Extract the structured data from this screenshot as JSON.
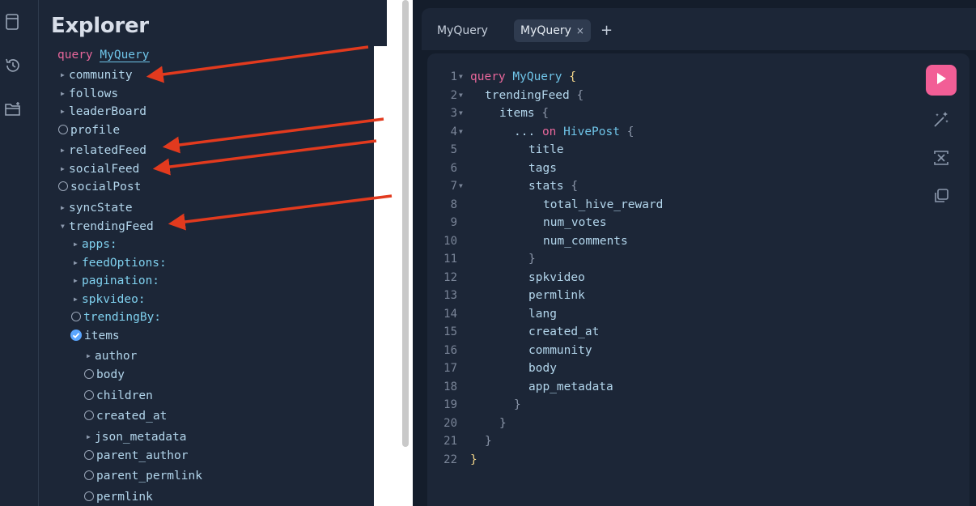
{
  "explorer": {
    "title": "Explorer",
    "query_keyword": "query",
    "query_name": "MyQuery",
    "root_fields": [
      {
        "label": "community",
        "kind": "caret"
      },
      {
        "label": "follows",
        "kind": "caret"
      },
      {
        "label": "leaderBoard",
        "kind": "caret"
      },
      {
        "label": "profile",
        "kind": "radio"
      },
      {
        "label": "relatedFeed",
        "kind": "caret"
      },
      {
        "label": "socialFeed",
        "kind": "caret"
      },
      {
        "label": "socialPost",
        "kind": "radio"
      },
      {
        "label": "syncState",
        "kind": "caret"
      },
      {
        "label": "trendingFeed",
        "kind": "expanded"
      }
    ],
    "trending_args": [
      "apps:",
      "feedOptions:",
      "pagination:",
      "spkvideo:",
      "trendingBy:"
    ],
    "items_label": "items",
    "item_fields": [
      "author",
      "body",
      "children",
      "created_at",
      "json_metadata",
      "parent_author",
      "parent_permlink",
      "permlink"
    ]
  },
  "tabs": [
    {
      "label": "MyQuery"
    },
    {
      "label": "MyQuery",
      "close": "×"
    }
  ],
  "tab_add": "+",
  "editor": {
    "line_numbers": [
      "1",
      "2",
      "3",
      "4",
      "5",
      "6",
      "7",
      "8",
      "9",
      "10",
      "11",
      "12",
      "13",
      "14",
      "15",
      "16",
      "17",
      "18",
      "19",
      "20",
      "21",
      "22"
    ],
    "lines": {
      "l1_kw": "query",
      "l1_name": "MyQuery",
      "l1_brace": "{",
      "l2_field": "trendingFeed",
      "l2_brace": "{",
      "l3_field": "items",
      "l3_brace": "{",
      "l4_dots": "...",
      "l4_kw": "on",
      "l4_type": "HivePost",
      "l4_brace": "{",
      "l5": "title",
      "l6": "tags",
      "l7_field": "stats",
      "l7_brace": "{",
      "l8": "total_hive_reward",
      "l9": "num_votes",
      "l10": "num_comments",
      "l11": "}",
      "l12": "spkvideo",
      "l13": "permlink",
      "l14": "lang",
      "l15": "created_at",
      "l16": "community",
      "l17": "body",
      "l18": "app_metadata",
      "l19": "}",
      "l20": "}",
      "l21": "}",
      "l22": "}"
    }
  },
  "colors": {
    "background": "#1c2637",
    "keyword": "#e8679b",
    "field": "#b3d6ec",
    "run_button": "#f25e96",
    "checked": "#5aa6ff",
    "annotation_arrow": "#e23a1e"
  },
  "icons": [
    "docs-icon",
    "history-icon",
    "new-folder-icon",
    "run-icon",
    "prettify-icon",
    "merge-icon",
    "copy-icon"
  ]
}
